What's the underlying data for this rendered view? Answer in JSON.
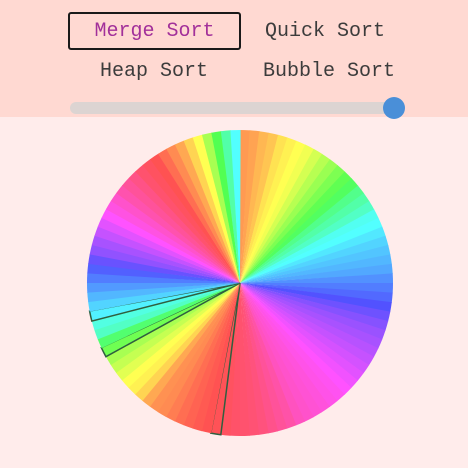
{
  "algorithms": [
    {
      "label": "Merge Sort",
      "selected": true
    },
    {
      "label": "Quick Sort",
      "selected": false
    },
    {
      "label": "Heap Sort",
      "selected": false
    },
    {
      "label": "Bubble Sort",
      "selected": false
    }
  ],
  "slider": {
    "value": 0.97
  },
  "wheel": {
    "slice_count": 100,
    "hues": [
      25,
      28,
      35,
      40,
      50,
      55,
      60,
      65,
      75,
      85,
      95,
      105,
      115,
      125,
      140,
      150,
      160,
      175,
      180,
      188,
      195,
      200,
      205,
      210,
      218,
      225,
      232,
      240,
      250,
      258,
      265,
      270,
      275,
      280,
      285,
      290,
      295,
      300,
      305,
      308,
      312,
      315,
      318,
      322,
      330,
      335,
      340,
      345,
      348,
      350,
      352,
      355,
      358,
      0,
      3,
      6,
      10,
      15,
      20,
      22,
      30,
      45,
      55,
      60,
      70,
      80,
      90,
      110,
      130,
      160,
      170,
      185,
      195,
      205,
      215,
      225,
      235,
      248,
      262,
      270,
      280,
      290,
      300,
      310,
      318,
      328,
      335,
      342,
      350,
      355,
      0,
      10,
      20,
      30,
      45,
      60,
      90,
      120,
      150,
      180
    ],
    "highlighted_slices": [
      52,
      67,
      71
    ]
  },
  "colors": {
    "header_bg": "#ffd9d2",
    "body_bg": "#ffeceb",
    "selected_text": "#a2309a",
    "slider_thumb": "#4a8fd8"
  }
}
